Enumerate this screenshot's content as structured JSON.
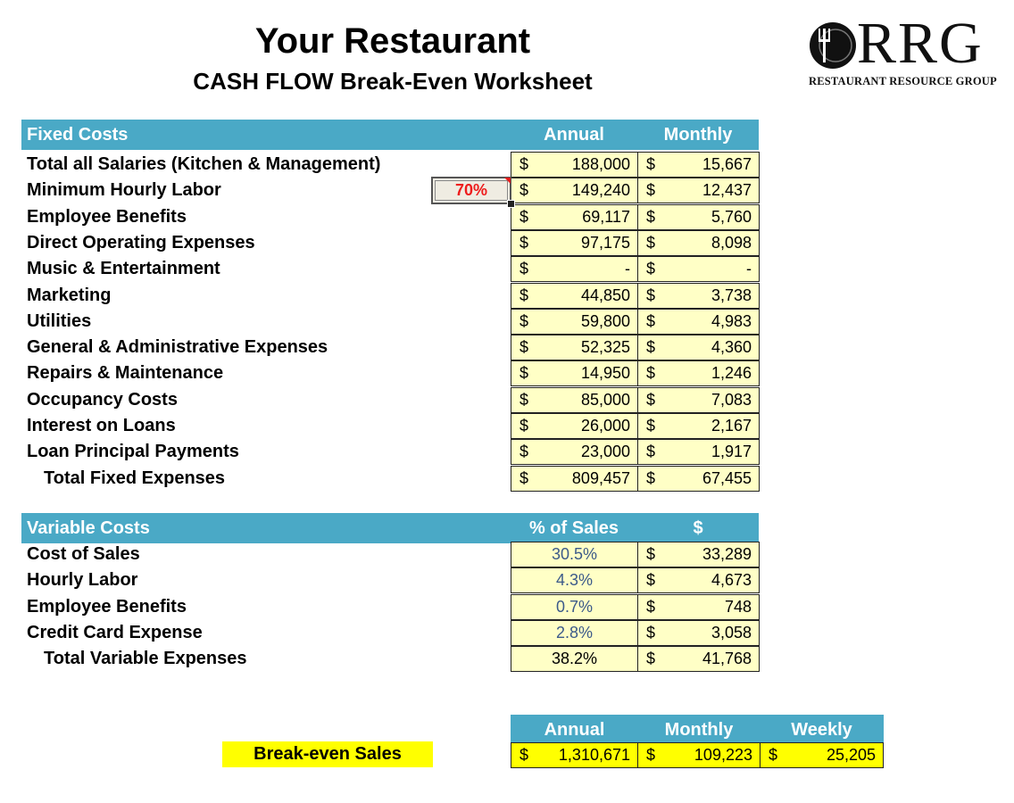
{
  "header": {
    "title": "Your Restaurant",
    "subtitle": "CASH FLOW Break-Even Worksheet"
  },
  "logo": {
    "mark": "RRG",
    "tagline": "RESTAURANT RESOURCE GROUP",
    "icon": "plate-fork-knife-icon"
  },
  "fixed_costs": {
    "section_label": "Fixed Costs",
    "columns": [
      "Annual",
      "Monthly"
    ],
    "currency": "$",
    "hourly_labor_input": "70%",
    "rows": [
      {
        "label": "Total all Salaries (Kitchen & Management)",
        "annual": "188,000",
        "monthly": "15,667"
      },
      {
        "label": "Minimum Hourly Labor",
        "annual": "149,240",
        "monthly": "12,437"
      },
      {
        "label": "Employee Benefits",
        "annual": "69,117",
        "monthly": "5,760"
      },
      {
        "label": "Direct Operating Expenses",
        "annual": "97,175",
        "monthly": "8,098"
      },
      {
        "label": "Music & Entertainment",
        "annual": "-",
        "monthly": "-"
      },
      {
        "label": "Marketing",
        "annual": "44,850",
        "monthly": "3,738"
      },
      {
        "label": "Utilities",
        "annual": "59,800",
        "monthly": "4,983"
      },
      {
        "label": "General & Administrative Expenses",
        "annual": "52,325",
        "monthly": "4,360"
      },
      {
        "label": "Repairs & Maintenance",
        "annual": "14,950",
        "monthly": "1,246"
      },
      {
        "label": "Occupancy Costs",
        "annual": "85,000",
        "monthly": "7,083"
      },
      {
        "label": "Interest on Loans",
        "annual": "26,000",
        "monthly": "2,167"
      },
      {
        "label": "Loan Principal Payments",
        "annual": "23,000",
        "monthly": "1,917"
      }
    ],
    "total": {
      "label": "Total Fixed Expenses",
      "annual": "809,457",
      "monthly": "67,455"
    }
  },
  "variable_costs": {
    "section_label": "Variable Costs",
    "columns": [
      "% of Sales",
      "$"
    ],
    "currency": "$",
    "rows": [
      {
        "label": "Cost of Sales",
        "pct": "30.5%",
        "amount": "33,289"
      },
      {
        "label": "Hourly Labor",
        "pct": "4.3%",
        "amount": "4,673"
      },
      {
        "label": "Employee Benefits",
        "pct": "0.7%",
        "amount": "748"
      },
      {
        "label": "Credit Card Expense",
        "pct": "2.8%",
        "amount": "3,058"
      }
    ],
    "total": {
      "label": "Total Variable Expenses",
      "pct": "38.2%",
      "amount": "41,768"
    }
  },
  "break_even": {
    "label": "Break-even Sales",
    "columns": [
      "Annual",
      "Monthly",
      "Weekly"
    ],
    "currency": "$",
    "annual": "1,310,671",
    "monthly": "109,223",
    "weekly": "25,205"
  },
  "colors": {
    "header_bar": "#4aa9c6",
    "cell_fill": "#ffffc6",
    "highlight": "#ffff00",
    "input_text": "#ee1c1c",
    "pct_text": "#3c5a8a"
  }
}
